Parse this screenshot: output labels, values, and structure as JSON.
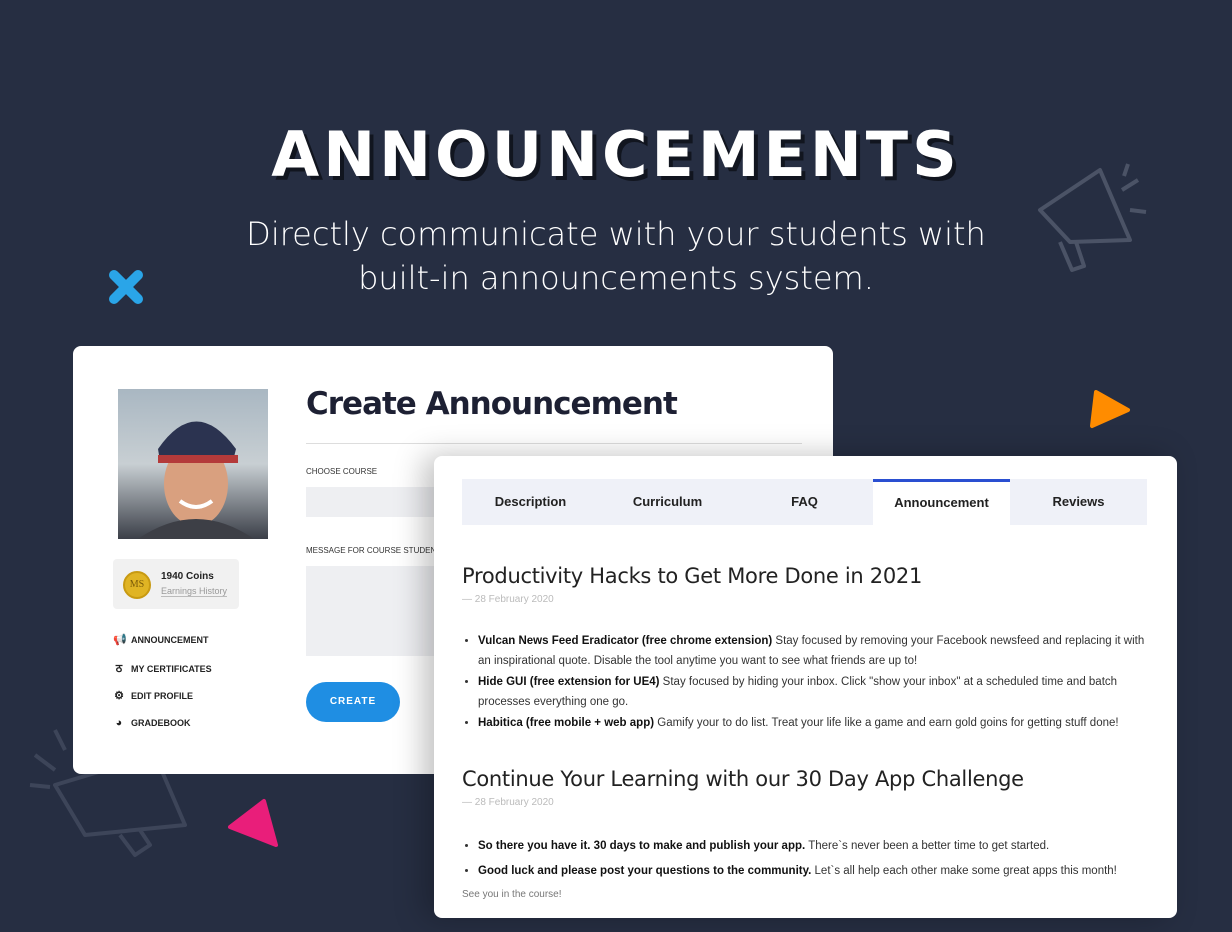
{
  "hero": {
    "title": "ANNOUNCEMENTS",
    "subtitle_line1": "Directly communicate with your students with",
    "subtitle_line2": "built-in announcements system."
  },
  "colors": {
    "background": "#262e42",
    "accent_blue": "#1f8ee3",
    "tab_active": "#2a4fd1",
    "deco_orange": "#ff8c00",
    "deco_pink": "#e91e7a",
    "deco_blue": "#2aa5e8"
  },
  "profile": {
    "coins": "1940 Coins",
    "coin_logo": "MS",
    "earnings_link": "Earnings History"
  },
  "menu": [
    {
      "icon": "megaphone-icon",
      "label": "ANNOUNCEMENT"
    },
    {
      "icon": "medal-icon",
      "label": "MY CERTIFICATES"
    },
    {
      "icon": "gear-icon",
      "label": "EDIT PROFILE"
    },
    {
      "icon": "pie-chart-icon",
      "label": "GRADEBOOK"
    }
  ],
  "create_form": {
    "title": "Create Announcement",
    "course_label": "CHOOSE COURSE",
    "message_label": "MESSAGE FOR COURSE STUDENTS",
    "submit": "CREATE"
  },
  "tabs": [
    "Description",
    "Curriculum",
    "FAQ",
    "Announcement",
    "Reviews"
  ],
  "active_tab": "Announcement",
  "announcements": [
    {
      "title": "Productivity Hacks to Get More Done in 2021",
      "date": "— 28 February 2020",
      "items": [
        {
          "bold": "Vulcan News Feed Eradicator (free chrome extension)",
          "text": " Stay focused by removing your Facebook newsfeed and replacing it with an inspirational quote. Disable the tool anytime you want to see what friends are up to!"
        },
        {
          "bold": "Hide GUI (free  extension for UE4)",
          "text": " Stay focused by hiding your inbox. Click \"show your inbox\" at a scheduled time and batch processes everything one go."
        },
        {
          "bold": "Habitica (free mobile + web app)",
          "text": " Gamify your to do list. Treat your life like a game and earn gold goins for getting stuff done!"
        }
      ]
    },
    {
      "title": "Continue Your Learning with our 30 Day App Challenge",
      "date": "— 28 February 2020",
      "items": [
        {
          "bold": "So there you have it. 30 days to make and publish your app.",
          "text": " There`s never been a better time to get started."
        },
        {
          "bold": "Good luck and please post your questions to the community.",
          "text": " Let`s all help each other make some great apps this month!"
        }
      ],
      "footer": "See you in the course!"
    }
  ]
}
